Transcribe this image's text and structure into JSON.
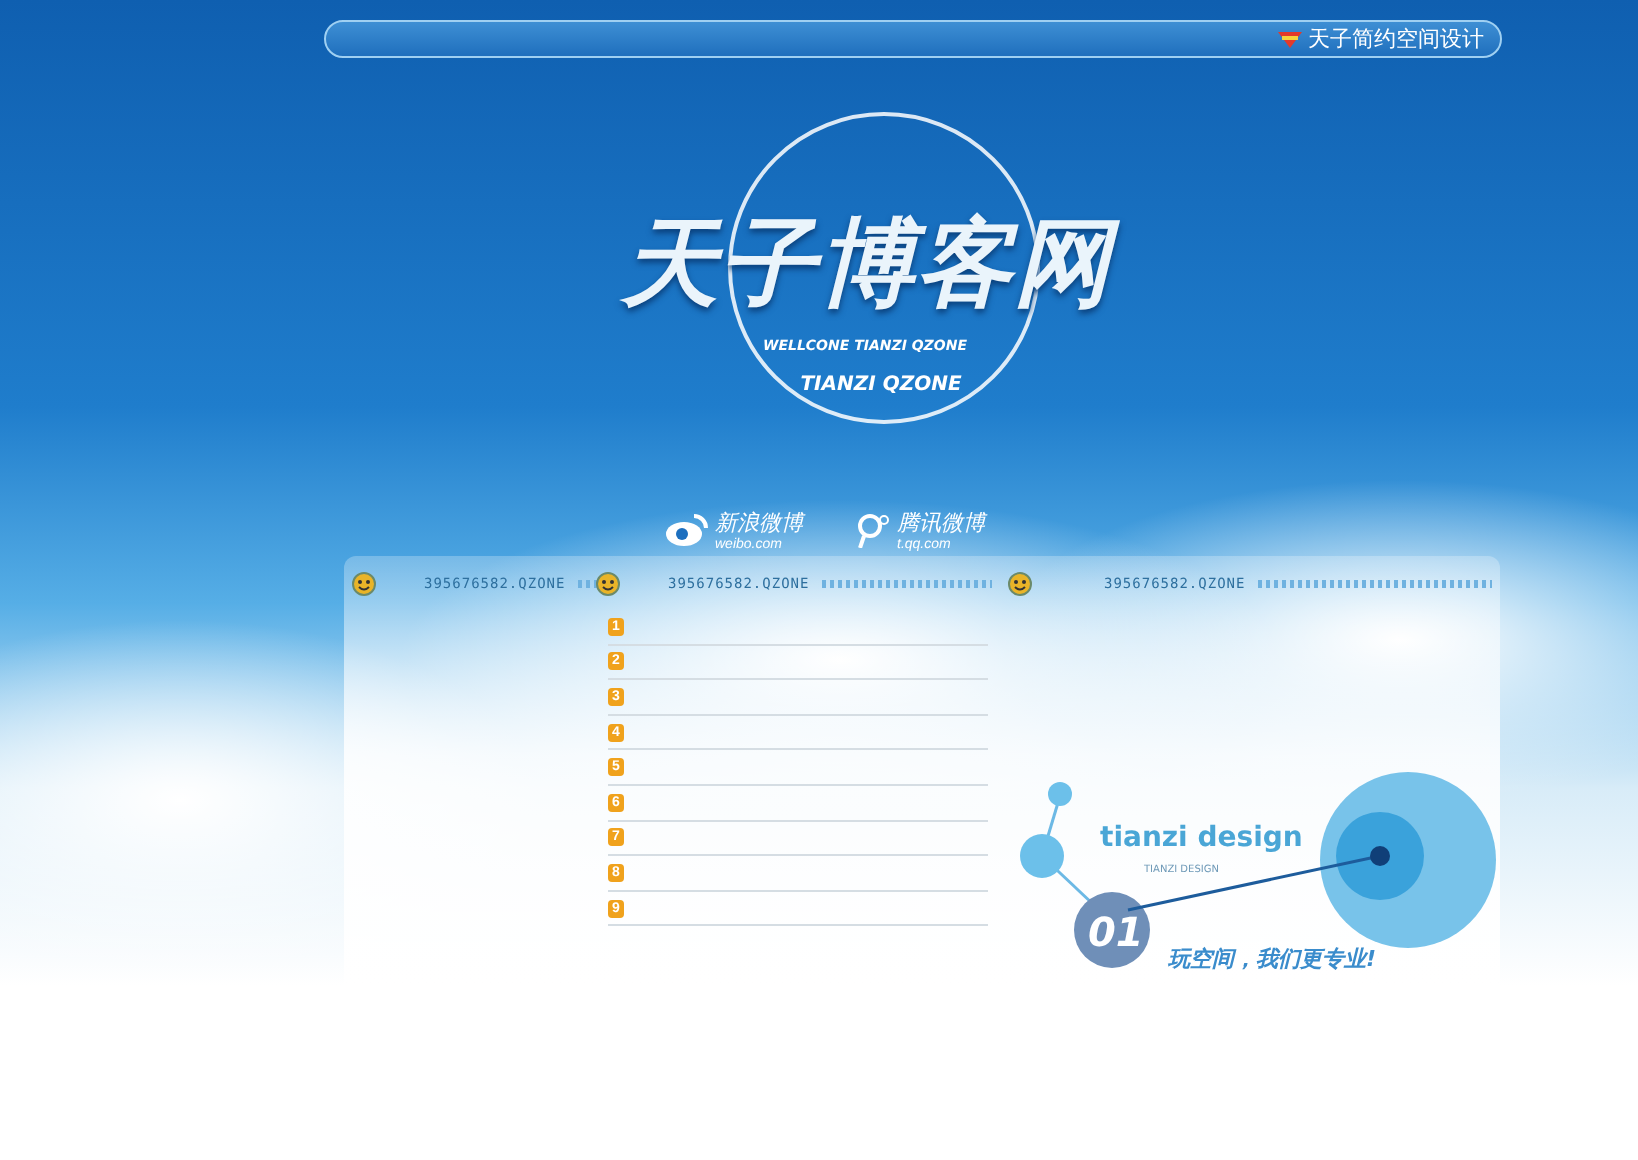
{
  "top_bar": {
    "link": "天子简约空间设计"
  },
  "hero": {
    "title": "天子博客网",
    "subtitle": "WELLCONE TIANZI QZONE",
    "tagline": "TIANZI QZONE"
  },
  "social_links": [
    {
      "kind": "weibo",
      "name": "新浪微博",
      "url": "weibo.com"
    },
    {
      "kind": "tencent",
      "name": "腾讯微博",
      "url": "t.qq.com"
    }
  ],
  "columns": [
    {
      "header": "395676582.QZONE"
    },
    {
      "header": "395676582.QZONE"
    },
    {
      "header": "395676582.QZONE"
    }
  ],
  "list": [
    {
      "number": "1"
    },
    {
      "number": "2"
    },
    {
      "number": "3"
    },
    {
      "number": "4"
    },
    {
      "number": "5"
    },
    {
      "number": "6"
    },
    {
      "number": "7"
    },
    {
      "number": "8"
    },
    {
      "number": "9"
    }
  ],
  "design": {
    "logo": "tianzi design",
    "caption": "TIANZI DESIGN",
    "number": "01",
    "slogan": "玩空间，我们更专业!"
  }
}
